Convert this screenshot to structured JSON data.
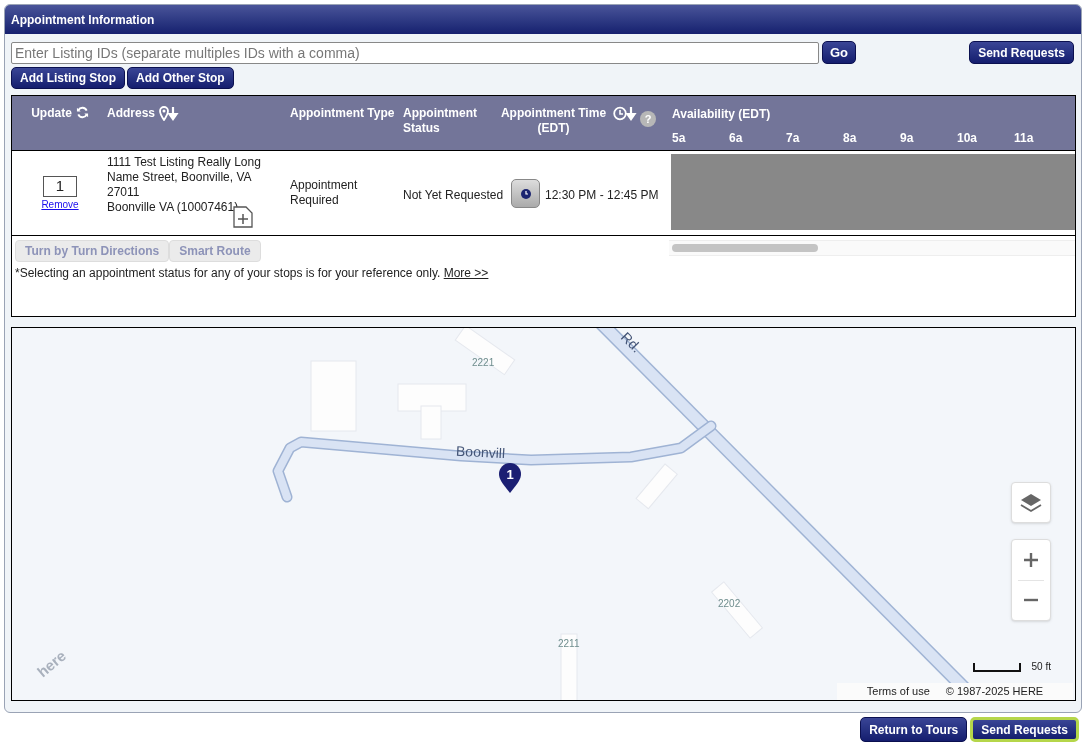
{
  "panel": {
    "title": "Appointment Information"
  },
  "listing_input": {
    "placeholder": "Enter Listing IDs (separate multiples IDs with a comma)"
  },
  "go_button": "Go",
  "top_send_button": "Send Requests",
  "stop_buttons": [
    "Add Listing Stop",
    "Add Other Stop"
  ],
  "table": {
    "columns": [
      {
        "label": "Update"
      },
      {
        "label": "Address"
      },
      {
        "label": "Appointment Type"
      },
      {
        "label": "Appointment Status"
      },
      {
        "label": "Appointment Time (EDT)"
      }
    ],
    "help": "?",
    "availability": {
      "title": "Availability (EDT)",
      "hours": [
        "5a",
        "6a",
        "7a",
        "8a",
        "9a",
        "10a",
        "11a"
      ]
    },
    "rows": [
      {
        "order": "1",
        "remove": "Remove",
        "address": [
          "1111 Test Listing Really Long",
          "Name Street, Boonville, VA",
          "27011",
          "Boonville VA (10007461)"
        ],
        "type": "Appointment Required",
        "status": "Not Yet Requested",
        "time": "12:30 PM - 12:45 PM"
      }
    ]
  },
  "route_buttons": [
    {
      "label": "Turn by Turn Directions",
      "disabled": true
    },
    {
      "label": "Smart Route",
      "disabled": true
    }
  ],
  "note": {
    "text": "*Selecting an appointment status for any of your stops is for your reference only.",
    "link": "More >>"
  },
  "map": {
    "labels": [
      {
        "text": "Rd.",
        "kind": "road"
      },
      {
        "text": "Boonvill",
        "kind": "road"
      },
      {
        "text": "2221",
        "kind": "house"
      },
      {
        "text": "2202",
        "kind": "house"
      },
      {
        "text": "2211",
        "kind": "house"
      }
    ],
    "logo": "here",
    "marker": "1",
    "scale": "50 ft",
    "terms": "Terms of use",
    "copyright": "© 1987-2025 HERE"
  },
  "footer_buttons": [
    {
      "label": "Return to Tours",
      "focused": false
    },
    {
      "label": "Send Requests",
      "focused": true
    }
  ]
}
